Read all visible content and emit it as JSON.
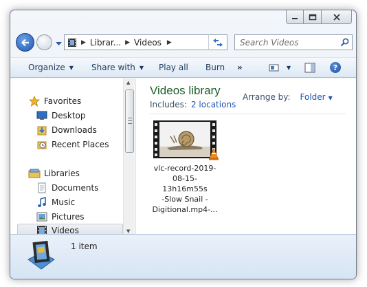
{
  "window": {
    "captions": {
      "minimize": "minimize-icon",
      "maximize": "maximize-icon",
      "close": "close-icon"
    }
  },
  "address_bar": {
    "breadcrumbs": [
      "Librar...",
      "Videos"
    ],
    "search_placeholder": "Search Videos"
  },
  "toolbar": {
    "organize": "Organize",
    "share_with": "Share with",
    "play_all": "Play all",
    "burn": "Burn",
    "more": "»",
    "help": "?"
  },
  "nav": {
    "favorites": {
      "label": "Favorites",
      "items": [
        "Desktop",
        "Downloads",
        "Recent Places"
      ]
    },
    "libraries": {
      "label": "Libraries",
      "items": [
        "Documents",
        "Music",
        "Pictures",
        "Videos"
      ],
      "selected": "Videos"
    }
  },
  "content": {
    "title": "Videos library",
    "includes_label": "Includes:",
    "locations_link": "2 locations",
    "arrange_label": "Arrange by:",
    "arrange_value": "Folder",
    "files": [
      {
        "name_lines": [
          "vlc-record-2019-",
          "08-15-13h16m55s",
          "-Slow Snail -",
          "Digitional.mp4-..."
        ]
      }
    ]
  },
  "details": {
    "item_count": "1 item"
  },
  "colors": {
    "title_green": "#1e5d2a",
    "link_blue": "#1f55b3",
    "toolbar_text": "#1e395b"
  }
}
